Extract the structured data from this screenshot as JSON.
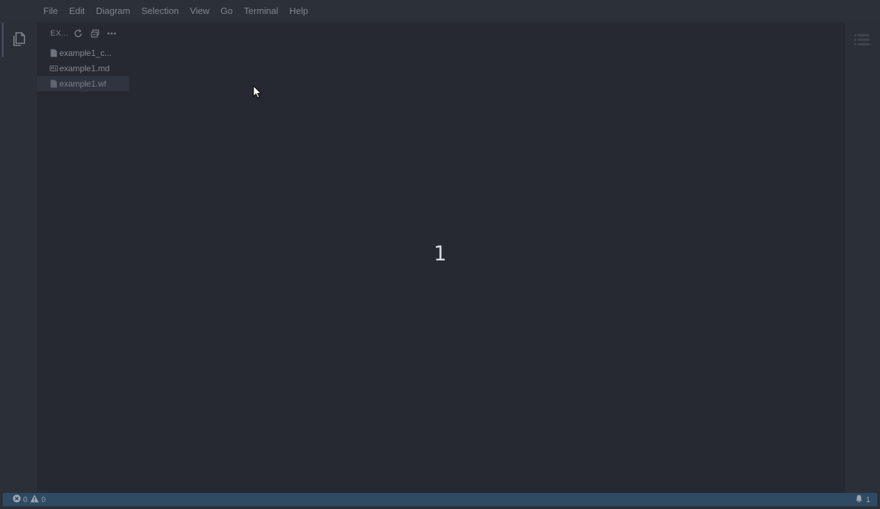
{
  "menubar": {
    "items": [
      "File",
      "Edit",
      "Diagram",
      "Selection",
      "View",
      "Go",
      "Terminal",
      "Help"
    ]
  },
  "activitybar": {
    "items": [
      {
        "icon": "files-icon",
        "active": true
      }
    ]
  },
  "explorer": {
    "title": "EX...",
    "actions": [
      "refresh-icon",
      "collapse-all-icon",
      "more-icon"
    ],
    "files": [
      {
        "label": "example1_c...",
        "icon": "file-icon",
        "selected": false
      },
      {
        "label": "example1.md",
        "icon": "markdown-icon",
        "selected": false
      },
      {
        "label": "example1.wf",
        "icon": "file-icon",
        "selected": true
      }
    ]
  },
  "editor": {
    "page_number": "1"
  },
  "statusbar": {
    "errors": "0",
    "warnings": "0",
    "notifications": "1"
  },
  "colors": {
    "background": "#262932",
    "menubar": "#2c3039",
    "statusbar": "#2f4a63"
  }
}
